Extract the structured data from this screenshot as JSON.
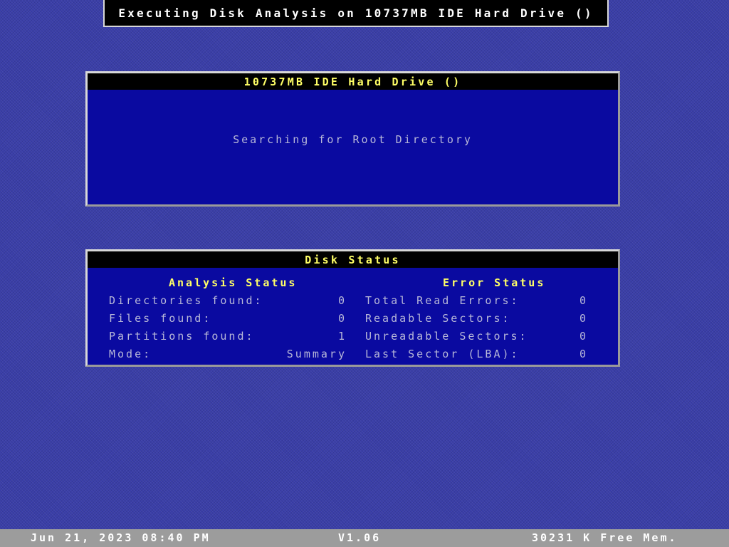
{
  "top_title": "Executing Disk Analysis on 10737MB IDE Hard Drive ()",
  "drive_panel": {
    "title": "10737MB IDE Hard Drive ()",
    "message": "Searching for Root Directory"
  },
  "status_panel": {
    "title": "Disk Status",
    "analysis": {
      "header": "Analysis Status",
      "rows": [
        {
          "label": "Directories found:",
          "value": "0"
        },
        {
          "label": "Files found:",
          "value": "0"
        },
        {
          "label": "Partitions found:",
          "value": "1"
        },
        {
          "label": "Mode:",
          "value": "Summary"
        }
      ]
    },
    "error": {
      "header": "Error Status",
      "rows": [
        {
          "label": "Total Read Errors:",
          "value": "0"
        },
        {
          "label": "Readable Sectors:",
          "value": "0"
        },
        {
          "label": "Unreadable Sectors:",
          "value": "0"
        },
        {
          "label": "Last Sector (LBA):",
          "value": "0"
        }
      ]
    }
  },
  "bottom_bar": {
    "datetime": "Jun 21, 2023 08:40 PM",
    "version": "V1.06",
    "memory": "30231 K Free Mem."
  },
  "colors": {
    "desktop": "#3a3ea8",
    "panel": "#0a0aa0",
    "header_bg": "#000000",
    "header_text": "#ffff66",
    "body_text": "#b8b8d8",
    "status_bar": "#9c9c9c"
  }
}
